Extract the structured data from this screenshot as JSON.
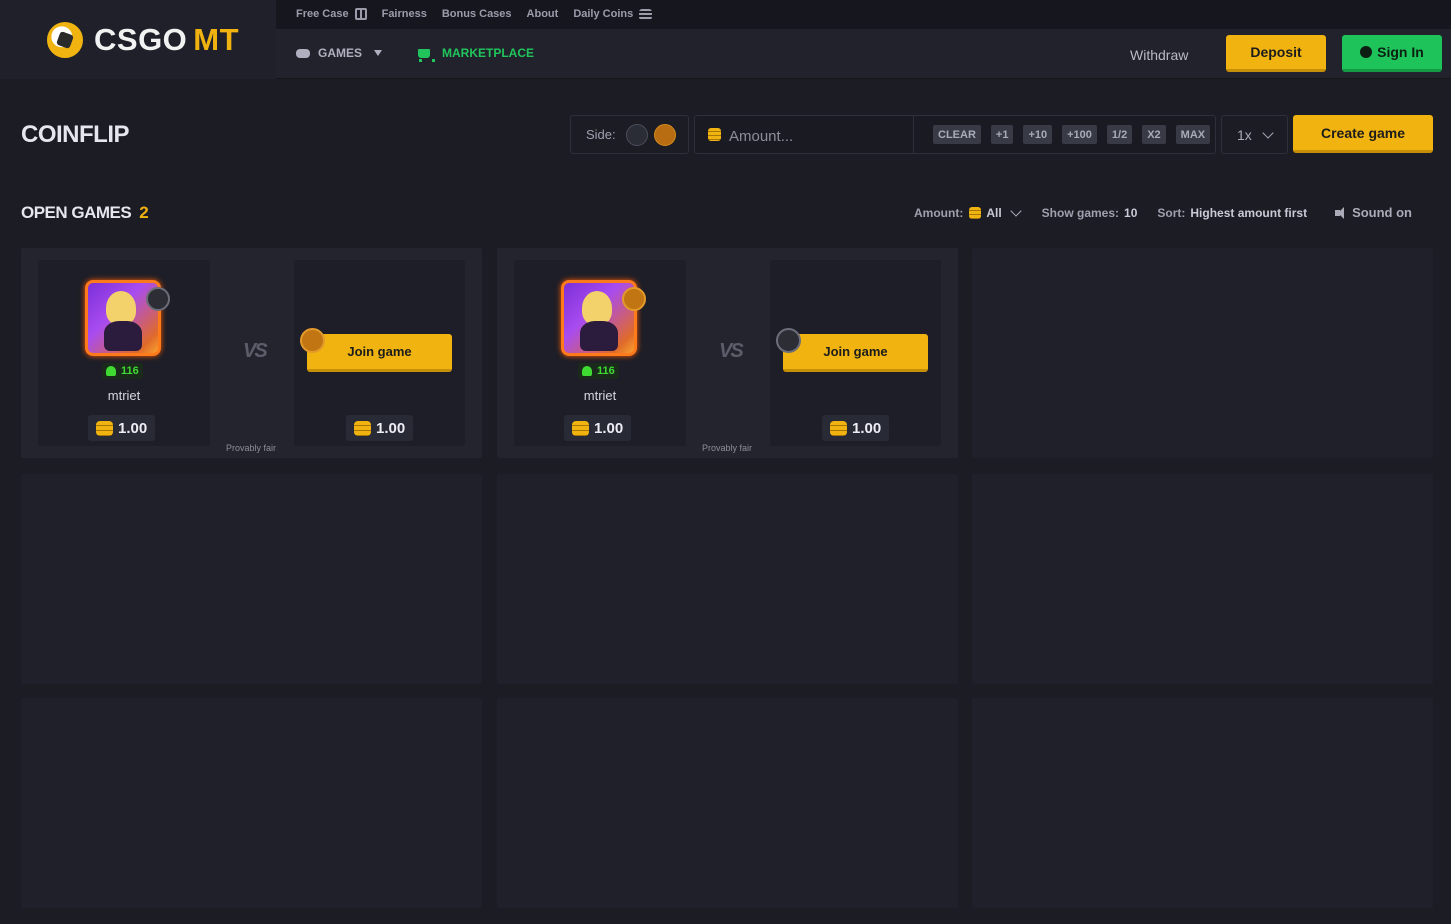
{
  "brand": {
    "name": "CSGO",
    "suffix": "MT"
  },
  "topbar": {
    "links": [
      {
        "label": "Free Case",
        "icon": "gift-icon"
      },
      {
        "label": "Fairness"
      },
      {
        "label": "Bonus Cases"
      },
      {
        "label": "About"
      },
      {
        "label": "Daily Coins",
        "icon": "coins-icon"
      }
    ]
  },
  "nav": {
    "games": "GAMES",
    "marketplace": "MARKETPLACE"
  },
  "account": {
    "withdraw": "Withdraw",
    "deposit": "Deposit",
    "signin": "Sign In"
  },
  "coinflip": {
    "title": "COINFLIP",
    "side_label": "Side:",
    "amount_placeholder": "Amount...",
    "chips": [
      "CLEAR",
      "+1",
      "+10",
      "+100",
      "1/2",
      "X2",
      "MAX"
    ],
    "multiplier": "1x",
    "create": "Create game"
  },
  "open_games": {
    "label": "OPEN GAMES",
    "count": "2",
    "amount_label": "Amount:",
    "amount_value": "All",
    "show_label": "Show games:",
    "show_value": "10",
    "sort_label": "Sort:",
    "sort_value": "Highest amount first",
    "sound": "Sound on"
  },
  "games": [
    {
      "player": "mtriet",
      "level": "116",
      "player_side": "ct",
      "opponent_side": "t",
      "bet": "1.00",
      "join_bet": "1.00",
      "vs": "VS",
      "fair": "Provably fair",
      "join": "Join game"
    },
    {
      "player": "mtriet",
      "level": "116",
      "player_side": "t",
      "opponent_side": "ct",
      "bet": "1.00",
      "join_bet": "1.00",
      "vs": "VS",
      "fair": "Provably fair",
      "join": "Join game"
    }
  ],
  "colors": {
    "accent": "#f0b310",
    "green": "#1ec45a",
    "bg": "#1b1c24"
  }
}
